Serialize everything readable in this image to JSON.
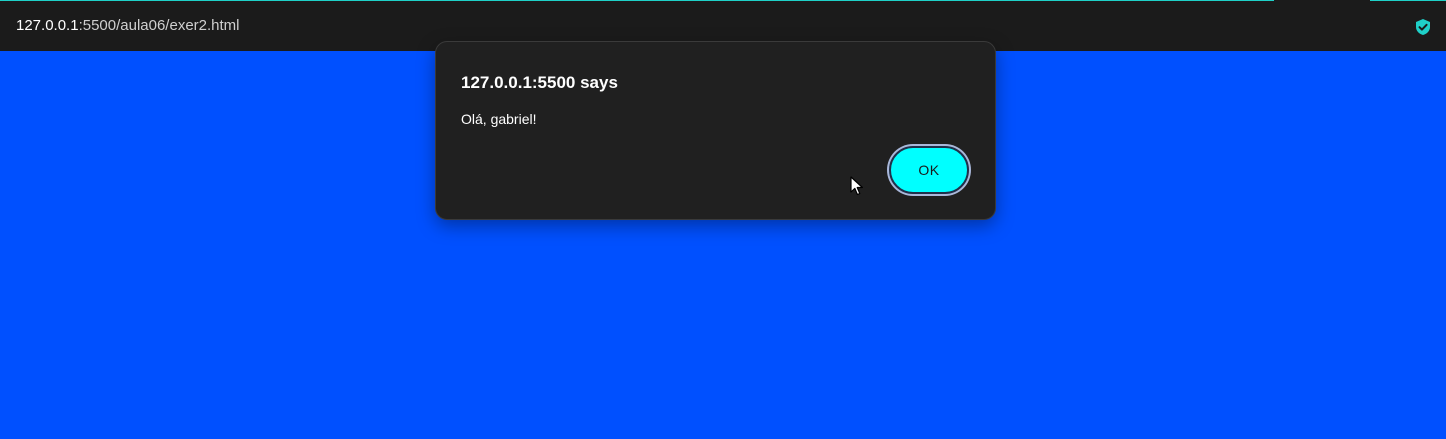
{
  "browser": {
    "url_host": "127.0.0.1",
    "url_rest": ":5500/aula06/exer2.html",
    "shield_icon": "shield-check-icon",
    "accent_color": "#1fd0c8"
  },
  "page": {
    "background_color": "#0050ff"
  },
  "alert_dialog": {
    "title": "127.0.0.1:5500 says",
    "message": "Olá, gabriel!",
    "ok_label": "OK",
    "ok_color": "#00ffff"
  },
  "cursor": {
    "icon": "mouse-pointer-icon"
  }
}
